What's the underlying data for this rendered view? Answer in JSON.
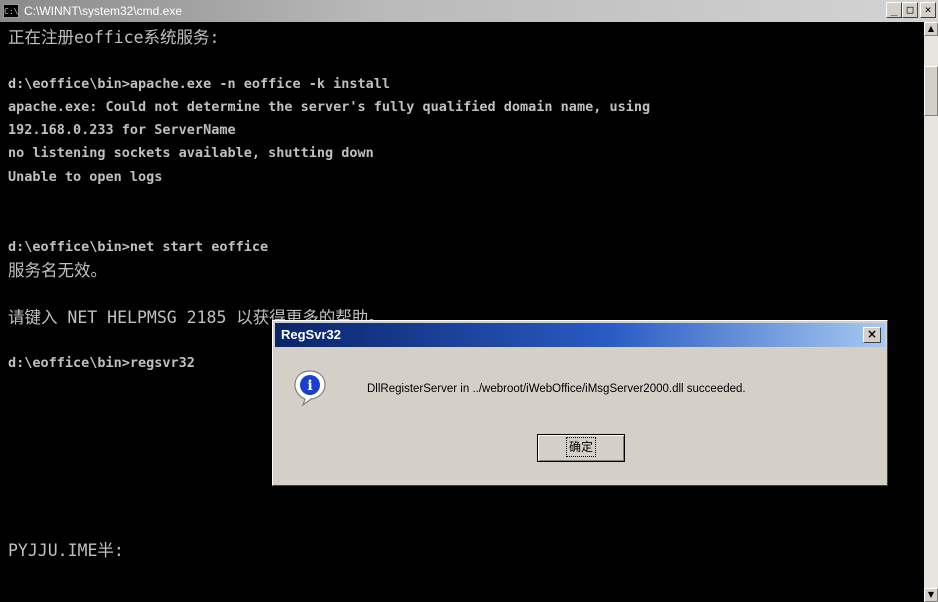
{
  "window": {
    "title": "C:\\WINNT\\system32\\cmd.exe",
    "icon_label": "C:\\",
    "controls": {
      "minimize": "_",
      "maximize": "□",
      "close": "×"
    }
  },
  "console": {
    "lines": [
      "正在注册eoffice系统服务:",
      "",
      "d:\\eoffice\\bin>apache.exe -n eoffice -k install",
      "apache.exe: Could not determine the server's fully qualified domain name, using",
      "192.168.0.233 for ServerName",
      "no listening sockets available, shutting down",
      "Unable to open logs",
      "",
      "",
      "d:\\eoffice\\bin>net start eoffice",
      "服务名无效。",
      "",
      "请键入 NET HELPMSG 2185 以获得更多的帮助。",
      "",
      "d:\\eoffice\\bin>regsvr32",
      "",
      "",
      "",
      "",
      "",
      "",
      "",
      "PYJJU.IME半:"
    ]
  },
  "scrollbar": {
    "up": "▲",
    "down": "▼"
  },
  "dialog": {
    "title": "RegSvr32",
    "close": "×",
    "message": "DllRegisterServer in ../webroot/iWebOffice/iMsgServer2000.dll succeeded.",
    "ok_label": "确定",
    "icon": "info-icon",
    "icon_glyph": "i"
  }
}
